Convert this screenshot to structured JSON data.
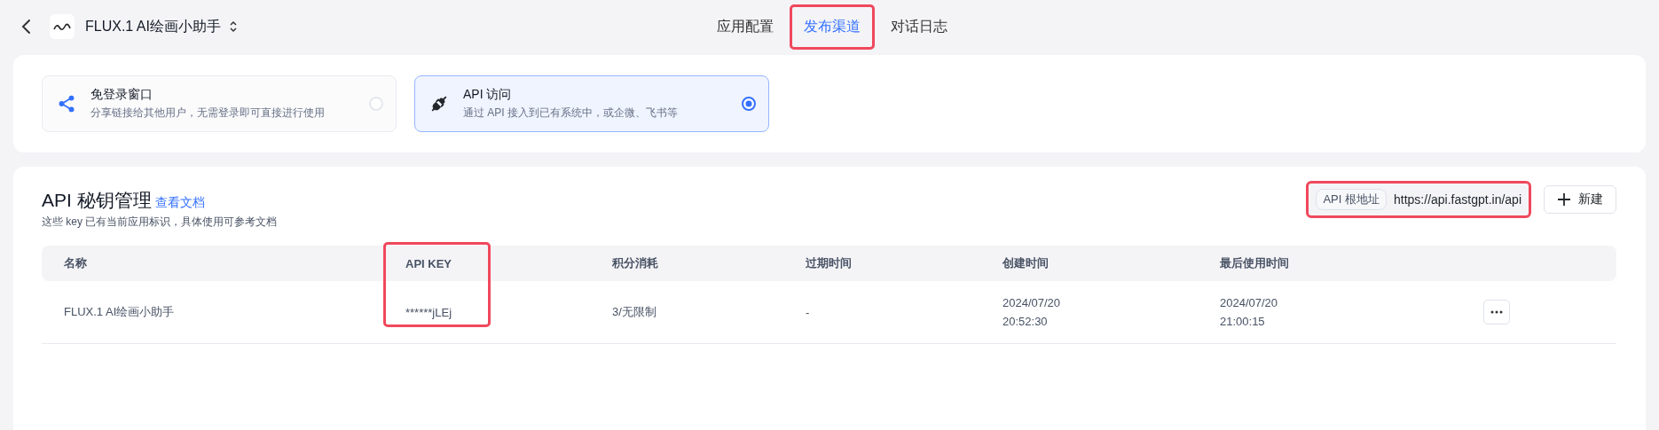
{
  "app": {
    "title": "FLUX.1 AI绘画小助手"
  },
  "tabs": [
    {
      "label": "应用配置",
      "selected": false,
      "highlighted": false
    },
    {
      "label": "发布渠道",
      "selected": true,
      "highlighted": true
    },
    {
      "label": "对话日志",
      "selected": false,
      "highlighted": false
    }
  ],
  "channels": [
    {
      "kind": "share",
      "title": "免登录窗口",
      "desc": "分享链接给其他用户，无需登录即可直接进行使用",
      "selected": false
    },
    {
      "kind": "api",
      "title": "API 访问",
      "desc": "通过 API 接入到已有系统中，或企微、飞书等",
      "selected": true
    }
  ],
  "keys": {
    "title": "API 秘钥管理",
    "doc_link": "查看文档",
    "subtitle": "这些 key 已有当前应用标识，具体使用可参考文档",
    "api_base": {
      "label": "API 根地址",
      "url": "https://api.fastgpt.in/api",
      "highlighted": true
    },
    "new_button": "新建",
    "columns": [
      {
        "label": "名称",
        "highlighted": false
      },
      {
        "label": "API KEY",
        "highlighted": true
      },
      {
        "label": "积分消耗",
        "highlighted": false
      },
      {
        "label": "过期时间",
        "highlighted": false
      },
      {
        "label": "创建时间",
        "highlighted": false
      },
      {
        "label": "最后使用时间",
        "highlighted": false
      }
    ],
    "rows": [
      {
        "cells": [
          [
            "FLUX.1 AI绘画小助手"
          ],
          [
            "******jLEj"
          ],
          [
            "3/无限制"
          ],
          [
            "-"
          ],
          [
            "2024/07/20",
            "20:52:30"
          ],
          [
            "2024/07/20",
            "21:00:15"
          ]
        ]
      }
    ]
  }
}
